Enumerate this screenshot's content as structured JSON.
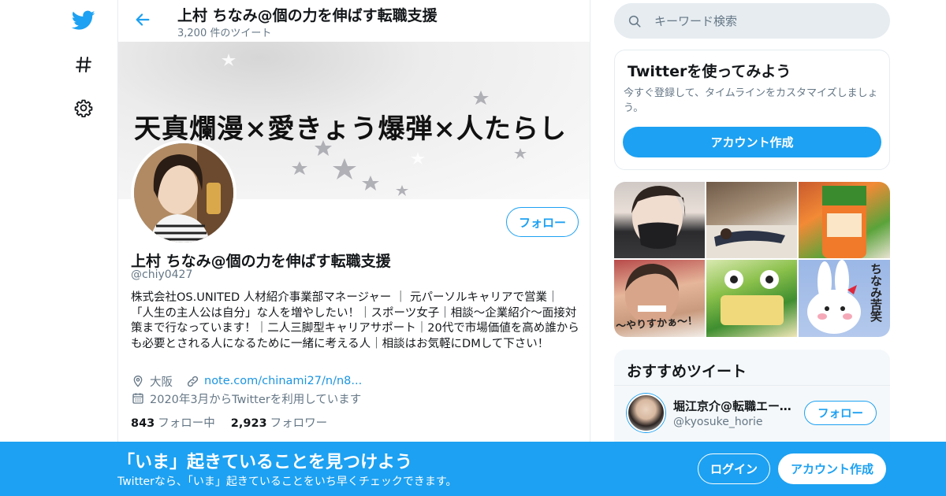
{
  "nav": {
    "icons": [
      "twitter-bird-icon",
      "hashtag-icon",
      "gear-icon"
    ]
  },
  "header": {
    "name": "上村 ちなみ@個の力を伸ばす転職支援",
    "tweet_count": "3,200 件のツイート"
  },
  "banner": {
    "text": "天真爛漫×愛きょう爆弾×人たらし"
  },
  "profile": {
    "follow_label": "フォロー",
    "name": "上村 ちなみ@個の力を伸ばす転職支援",
    "handle": "@chiy0427",
    "bio": "株式会社OS.UNITED 人材紹介事業部マネージャー ｜ 元パーソルキャリアで営業｜「人生の主人公は自分」な人を増やしたい！｜スポーツ女子｜相談〜企業紹介〜面接対策まで行なっています！｜二人三脚型キャリアサポート｜20代で市場価値を高め誰からも必要とされる人になるために一緒に考える人｜相談はお気軽にDMして下さい！",
    "location": "大阪",
    "link": "note.com/chinami27/n/n8...",
    "joined": "2020年3月からTwitterを利用しています",
    "following_count": "843",
    "following_label": "フォロー中",
    "followers_count": "2,923",
    "followers_label": "フォロワー"
  },
  "search": {
    "placeholder": "キーワード検索"
  },
  "try_card": {
    "title": "Twitterを使ってみよう",
    "description": "今すぐ登録して、タイムラインをカスタマイズしましょう。",
    "button": "アカウント作成"
  },
  "media": {
    "captions": [
      "ちなみ苦笑",
      "～やりすかぁ～！"
    ]
  },
  "recommended": {
    "title": "おすすめツイート",
    "users": [
      {
        "name": "堀江京介@転職エージェント",
        "handle": "@kyosuke_horie",
        "follow_label": "フォロー"
      }
    ]
  },
  "bottom_bar": {
    "title": "「いま」起きていることを見つけよう",
    "subtitle": "Twitterなら、「いま」起きていることをいち早くチェックできます。",
    "login": "ログイン",
    "signup": "アカウント作成"
  },
  "colors": {
    "accent": "#1da1f2",
    "secondary_text": "#657786",
    "border": "#e6ecf0"
  }
}
